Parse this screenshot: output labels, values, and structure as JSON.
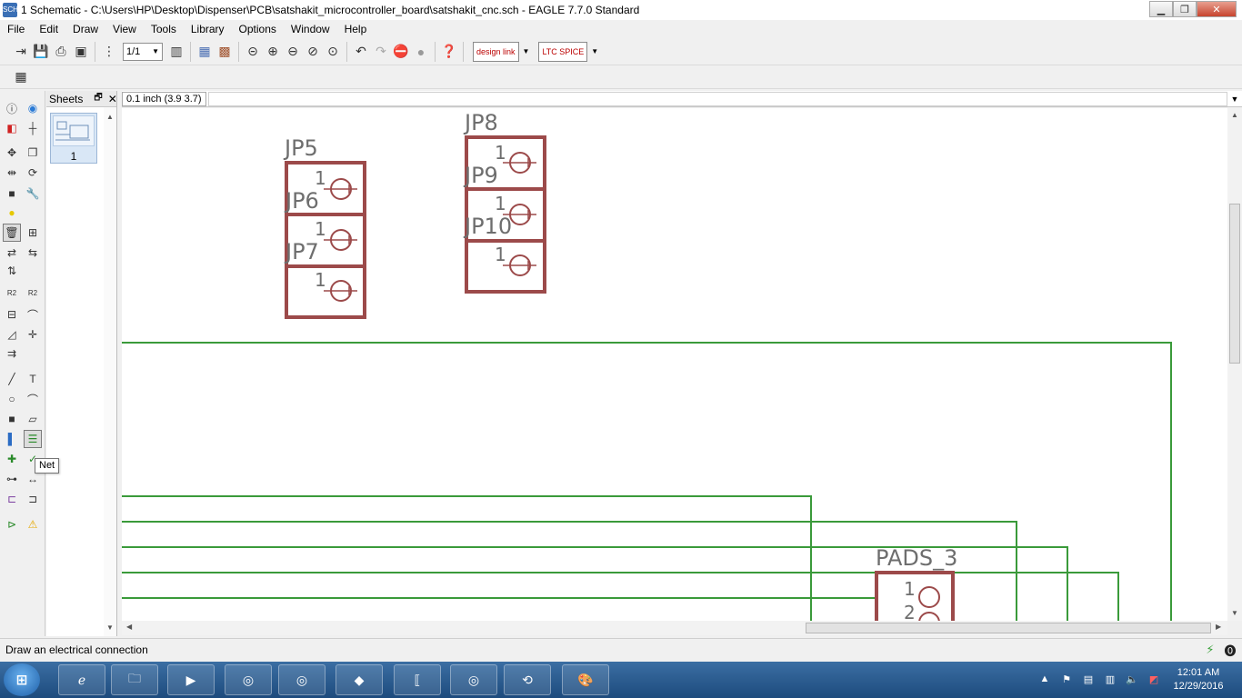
{
  "window": {
    "title": "1 Schematic - C:\\Users\\HP\\Desktop\\Dispenser\\PCB\\satshakit_microcontroller_board\\satshakit_cnc.sch - EAGLE 7.7.0 Standard",
    "app_icon": "SCH"
  },
  "menu": [
    "File",
    "Edit",
    "Draw",
    "View",
    "Tools",
    "Library",
    "Options",
    "Window",
    "Help"
  ],
  "toolbar": {
    "sheet_value": "1/1",
    "designlink_label": "design link",
    "ltspice_label": "LTC SPICE"
  },
  "sheets_panel": {
    "title": "Sheets",
    "sheet_number": "1"
  },
  "coords": {
    "readout": "0.1 inch (3.9 3.7)"
  },
  "schematic": {
    "parts": [
      {
        "name": "JP5",
        "pin": "1"
      },
      {
        "name": "JP6",
        "pin": "1"
      },
      {
        "name": "JP7",
        "pin": "1"
      },
      {
        "name": "JP8",
        "pin": "1"
      },
      {
        "name": "JP9",
        "pin": "1"
      },
      {
        "name": "JP10",
        "pin": "1"
      },
      {
        "name": "PADS_3",
        "pins": [
          "1",
          "2"
        ]
      }
    ],
    "part_color": "#9c4a4a",
    "net_color": "#3a9a3a"
  },
  "tooltip": "Net",
  "status": {
    "text": "Draw an electrical connection"
  },
  "taskbar": {
    "time": "12:01 AM",
    "date": "12/29/2016"
  }
}
